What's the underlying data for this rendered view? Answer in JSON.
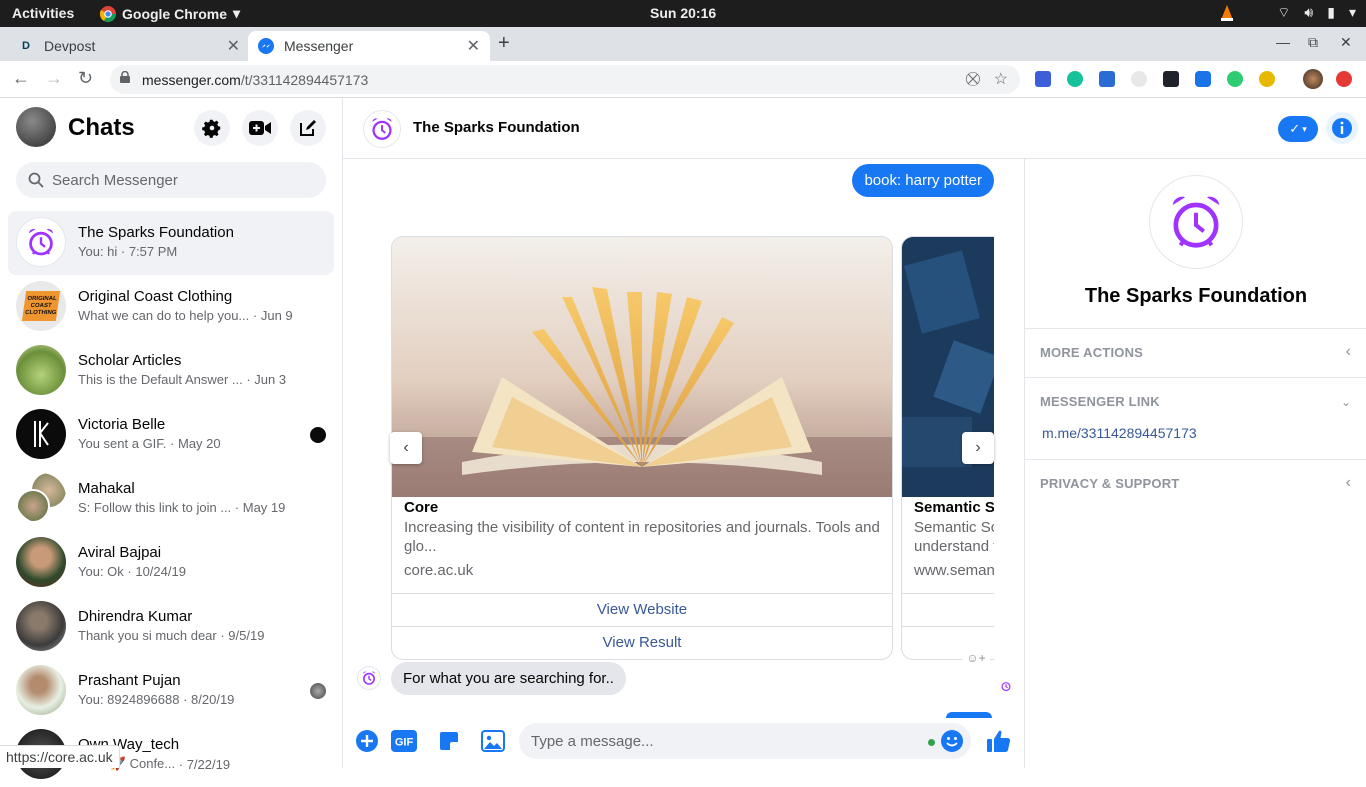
{
  "topbar": {
    "activities": "Activities",
    "app_name": "Google Chrome",
    "clock": "Sun 20:16"
  },
  "browser": {
    "tabs": [
      {
        "title": "Devpost",
        "active": false
      },
      {
        "title": "Messenger",
        "active": true
      }
    ],
    "url_host": "messenger.com",
    "url_path": "/t/331142894457173",
    "status_url": "https://core.ac.uk"
  },
  "sidebar": {
    "title": "Chats",
    "search_placeholder": "Search Messenger",
    "chats": [
      {
        "name": "The Sparks Foundation",
        "snippet": "You: hi",
        "time": "7:57 PM",
        "active": true
      },
      {
        "name": "Original Coast Clothing",
        "snippet": "What we can do to help you...",
        "time": "Jun 9"
      },
      {
        "name": "Scholar Articles",
        "snippet": "This is the Default Answer ...",
        "time": "Jun 3"
      },
      {
        "name": "Victoria Belle",
        "snippet": "You sent a GIF.",
        "time": "May 20"
      },
      {
        "name": "Mahakal",
        "snippet": "S: Follow this link to join ...",
        "time": "May 19"
      },
      {
        "name": "Aviral Bajpai",
        "snippet": "You: Ok",
        "time": "10/24/19"
      },
      {
        "name": "Dhirendra Kumar",
        "snippet": "Thank you si much dear",
        "time": "9/5/19"
      },
      {
        "name": "Prashant Pujan",
        "snippet": "You: 8924896688",
        "time": "8/20/19"
      },
      {
        "name": "Own Way_tech",
        "snippet": "tech: 🚀 Confe...",
        "time": "7/22/19"
      }
    ],
    "org_logo_text": "ORIGINAL COAST CLOTHING"
  },
  "conversation": {
    "name": "The Sparks Foundation",
    "outgoing_message": "book: harry potter",
    "cards": [
      {
        "title": "Core",
        "description": "Increasing the visibility of content in repositories and journals. Tools and glo...",
        "site": "core.ac.uk",
        "buttons": [
          "View Website",
          "View Result"
        ]
      },
      {
        "title": "Semantic S",
        "description": "Semantic Sc understand t",
        "site": "www.seman",
        "buttons": [
          "",
          ""
        ]
      }
    ],
    "incoming_message": "For what you are searching for..",
    "composer_placeholder": "Type a message..."
  },
  "info_panel": {
    "name": "The Sparks Foundation",
    "sections": [
      {
        "label": "MORE ACTIONS"
      },
      {
        "label": "MESSENGER LINK",
        "link": "m.me/331142894457173"
      },
      {
        "label": "PRIVACY & SUPPORT"
      }
    ]
  },
  "colors": {
    "brand_blue": "#1877f2",
    "alarm_purple": "#a033ff",
    "link_blue": "#385898"
  }
}
